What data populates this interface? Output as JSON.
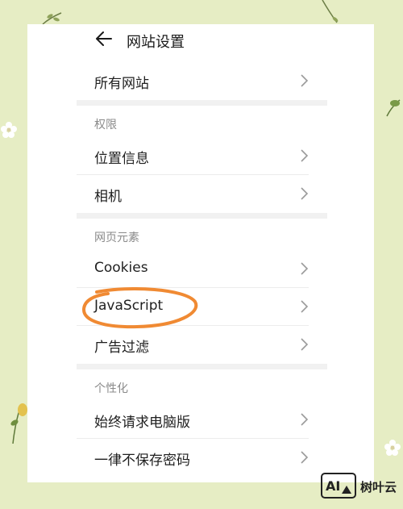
{
  "header": {
    "title": "网站设置"
  },
  "rows": {
    "all_sites": "所有网站",
    "location": "位置信息",
    "camera": "相机",
    "cookies": "Cookies",
    "javascript": "JavaScript",
    "ads": "广告过滤",
    "desktop": "始终请求电脑版",
    "no_save_password": "一律不保存密码"
  },
  "sections": {
    "permissions": "权限",
    "page_elements": "网页元素",
    "personalization": "个性化"
  },
  "watermark": {
    "logo": "AI",
    "text": "树叶云"
  },
  "colors": {
    "background": "#e6edc4",
    "highlight": "#f08a33"
  },
  "icons": {
    "back": "arrow-left-icon",
    "chevron": "chevron-right-icon"
  }
}
